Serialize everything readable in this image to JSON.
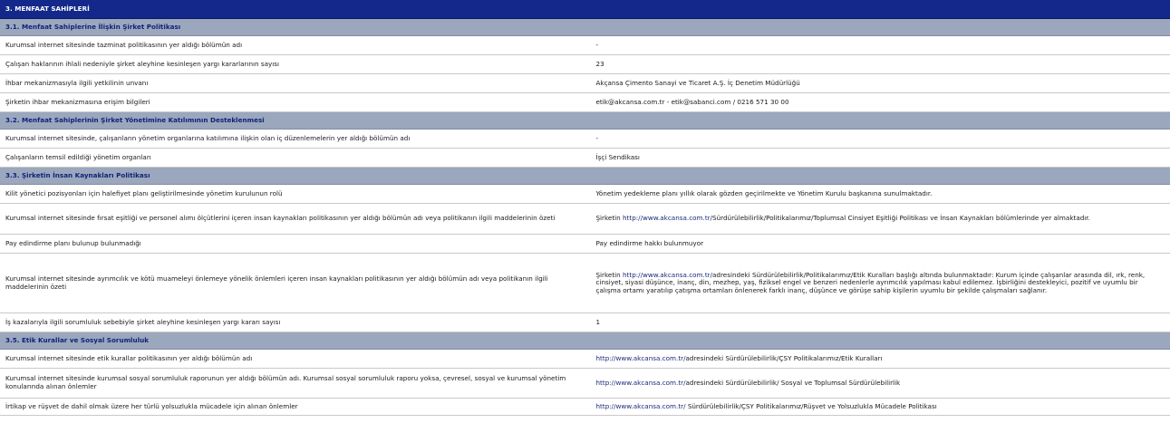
{
  "main_title": "3. MENFAAT SAHİPLERİ",
  "sections": [
    {
      "title": "3.1. Menfaat Sahiplerine İlişkin Şirket Politikası",
      "rows": [
        {
          "q": "Kurumsal internet sitesinde tazminat politikasının yer aldığı bölümün adı",
          "a": "-"
        },
        {
          "q": "Çalışan haklarının ihlali nedeniyle şirket aleyhine kesinleşen yargı kararlarının sayısı",
          "a": "23"
        },
        {
          "q": "İhbar mekanizmasıyla ilgili yetkilinin unvanı",
          "a": "Akçansa Çimento Sanayi ve Ticaret A.Ş. İç Denetim Müdürlüğü"
        },
        {
          "q": "Şirketin ihbar mekanizmasına erişim bilgileri",
          "a": "etik@akcansa.com.tr - etik@sabanci.com / 0216 571 30 00"
        }
      ]
    },
    {
      "title": "3.2. Menfaat Sahiplerinin Şirket Yönetimine Katılımının Desteklenmesi",
      "rows": [
        {
          "q": "Kurumsal internet sitesinde, çalışanların yönetim organlarına katılımına ilişkin olan iç düzenlemelerin yer aldığı bölümün adı",
          "a": "-"
        },
        {
          "q": "Çalışanların temsil edildiği yönetim organları",
          "a": "İşçi Sendikası"
        }
      ]
    },
    {
      "title": "3.3. Şirketin İnsan Kaynakları Politikası",
      "rows": [
        {
          "q": "Kilit yönetici pozisyonları için halefiyet planı geliştirilmesinde yönetim kurulunun rolü",
          "a": "Yönetim yedekleme planı yıllık olarak gözden geçirilmekte ve Yönetim Kurulu başkanına sunulmaktadır."
        },
        {
          "q": "Kurumsal internet sitesinde fırsat eşitliği ve personel alımı ölçütlerini içeren insan kaynakları politikasının yer aldığı bölümün adı veya politikanın ilgili maddelerinin özeti",
          "a_prefix": "Şirketin ",
          "a_url": "http://www.akcansa.com.tr/",
          "a_suffix": "Sürdürülebilirlik/Politikalarımız/Toplumsal Cinsiyet Eşitliği Politikası ve İnsan Kaynakları bölümlerinde yer almaktadır."
        },
        {
          "q": "Pay edindirme planı bulunup bulunmadığı",
          "a": "Pay edindirme hakkı bulunmuyor"
        },
        {
          "q": "Kurumsal internet sitesinde ayrımcılık ve kötü muameleyi önlemeye yönelik önlemleri içeren insan kaynakları politikasının yer aldığı bölümün adı veya politikanın ilgili maddelerinin özeti",
          "a_prefix": "Şirketin ",
          "a_url": "http://www.akcansa.com.tr/",
          "a_suffix": "adresindeki Sürdürülebilirlik/Politikalarımız/Etik Kuralları başlığı altında bulunmaktadır: Kurum içinde çalışanlar arasında dil, ırk, renk, cinsiyet, siyasi düşünce, inanç, din, mezhep, yaş, fiziksel engel ve benzeri nedenlerle ayrımcılık yapılması kabul edilemez. İşbirliğini destekleyici, pozitif ve uyumlu bir çalışma ortamı yaratılıp çatışma ortamları önlenerek farklı inanç, düşünce ve görüşe sahip kişilerin uyumlu bir şekilde çalışmaları sağlanır."
        },
        {
          "q": "İş kazalarıyla ilgili sorumluluk sebebiyle şirket aleyhine kesinleşen yargı kararı sayısı",
          "a": "1"
        }
      ]
    },
    {
      "title": "3.5. Etik Kurallar ve Sosyal Sorumluluk",
      "rows": [
        {
          "q": "Kurumsal internet sitesinde etik kurallar politikasının yer aldığı bölümün adı",
          "a_prefix": " ",
          "a_url": "http://www.akcansa.com.tr/",
          "a_suffix": "adresindeki Sürdürülebilirlik/ÇSY Politikalarımız/Etik Kuralları"
        },
        {
          "q": "Kurumsal internet sitesinde kurumsal sosyal sorumluluk raporunun yer aldığı bölümün adı. Kurumsal sosyal sorumluluk raporu yoksa, çevresel, sosyal ve kurumsal yönetim konularında alınan önlemler",
          "a_prefix": "",
          "a_url": "http://www.akcansa.com.tr/",
          "a_suffix": "adresindeki Sürdürülebilirlik/ Sosyal ve Toplumsal Sürdürülebilirlik"
        },
        {
          "q": "İrtikap ve rüşvet de dahil olmak üzere her türlü yolsuzlukla mücadele için alınan önlemler",
          "a_prefix": "",
          "a_url": "http://www.akcansa.com.tr/",
          "a_suffix": " Sürdürülebilirlik/ÇSY Politikalarımız/Rüşvet ve Yolsuzlukla Mücadele Politikası"
        }
      ]
    }
  ]
}
